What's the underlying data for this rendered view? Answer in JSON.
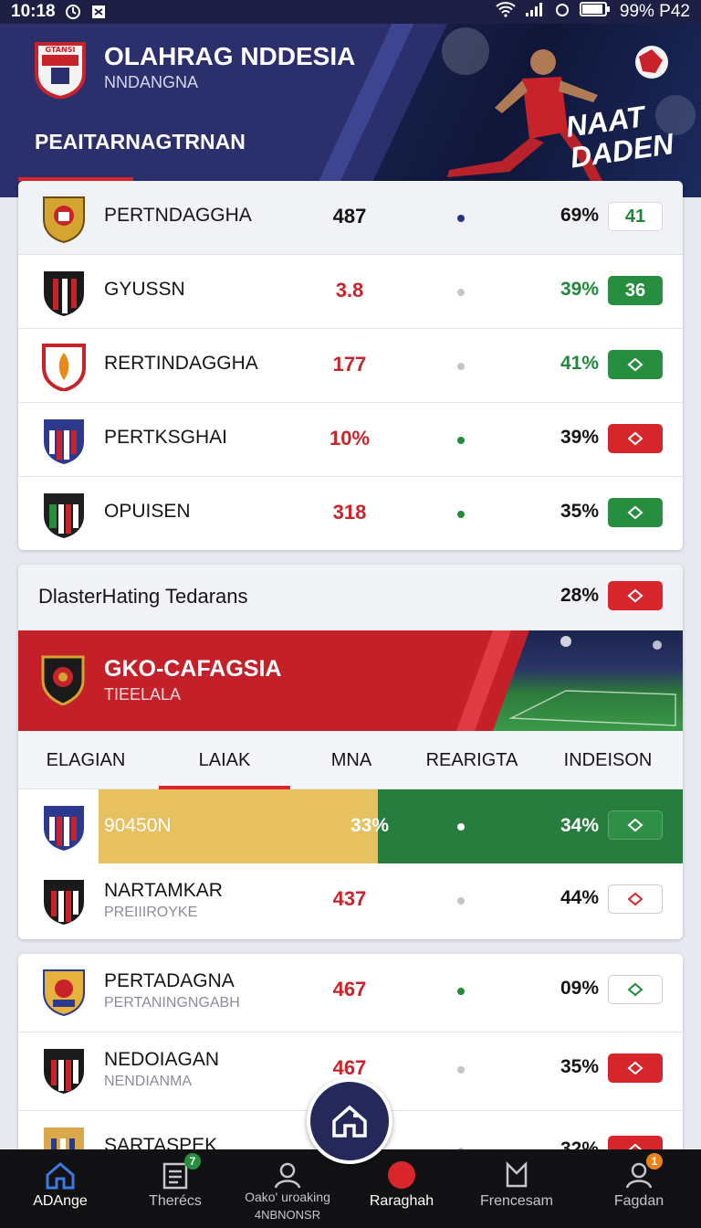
{
  "status_bar": {
    "time": "10:18",
    "battery_text": "99% P42"
  },
  "header": {
    "title": "OLAHRAG NDDESIA",
    "subtitle": "NNDANGNA",
    "section_title": "PEAITARNAGTRNAN",
    "slogan_line1": "NAAT",
    "slogan_line2": "DADEN",
    "crest_text": "GTANSI"
  },
  "standings": [
    {
      "name": "PERTNDAGGHA",
      "value": "487",
      "value_color": "dark",
      "dot": "navy",
      "percent": "69%",
      "percent_color": "dark",
      "badge": "41",
      "badge_style": "white",
      "crest": "gold"
    },
    {
      "name": "GYUSSN",
      "value": "3.8",
      "value_color": "red",
      "dot": "grey",
      "percent": "39%",
      "percent_color": "green",
      "badge": "36",
      "badge_style": "green",
      "crest": "black-red"
    },
    {
      "name": "RERTINDAGGHA",
      "value": "177",
      "value_color": "red",
      "dot": "grey",
      "percent": "41%",
      "percent_color": "green",
      "badge": "",
      "badge_style": "green",
      "crest": "red-flame"
    },
    {
      "name": "PERTKSGHAI",
      "value": "10%",
      "value_color": "red",
      "dot": "green",
      "percent": "39%",
      "percent_color": "dark",
      "badge": "",
      "badge_style": "red",
      "crest": "blue-red"
    },
    {
      "name": "OPUISEN",
      "value": "318",
      "value_color": "red",
      "dot": "green",
      "percent": "35%",
      "percent_color": "dark",
      "badge": "",
      "badge_style": "green",
      "crest": "green-red"
    }
  ],
  "match_card": {
    "heading": "DlasterHating Tedarans",
    "heading_percent": "28%",
    "banner_title": "GKO-CAFAGSIA",
    "banner_subtitle": "TIEELALA",
    "tabs": [
      "ELAGIAN",
      "LAIAK",
      "MNA",
      "REARIGTA",
      "INDEISON"
    ],
    "active_tab": 1,
    "rows": [
      {
        "name": "90450N",
        "value": "33%",
        "percent": "34%",
        "highlight": true
      },
      {
        "name": "NARTAMKAR",
        "sub": "PREIIIROYKE",
        "value": "437",
        "percent": "44%",
        "highlight": false
      }
    ]
  },
  "league_list": [
    {
      "name": "PERTADAGNA",
      "sub": "PERTANINGNGABH",
      "value": "467",
      "dot": "green",
      "percent": "09%",
      "badge_style": "outline-green"
    },
    {
      "name": "NEDOIAGAN",
      "sub": "NENDIANMA",
      "value": "467",
      "dot": "grey",
      "percent": "35%",
      "badge_style": "red"
    },
    {
      "name": "SARTASPEK",
      "sub": "",
      "value": "",
      "dot": "grey",
      "percent": "32%",
      "badge_style": "red"
    }
  ],
  "bottom_nav": [
    {
      "label": "ADAnge",
      "active": true
    },
    {
      "label": "Therécs",
      "badge": "7"
    },
    {
      "label": "Oako' uroaking",
      "label2": "4NBNONSR"
    },
    {
      "label": "Raraghah"
    },
    {
      "label": "Frencesam"
    },
    {
      "label": "Fagdan",
      "badge": "1"
    }
  ],
  "colors": {
    "brand_navy": "#2b2f6b",
    "accent_red": "#d8262c",
    "accent_green": "#268e3e",
    "highlight_yellow": "#e7c05f"
  }
}
